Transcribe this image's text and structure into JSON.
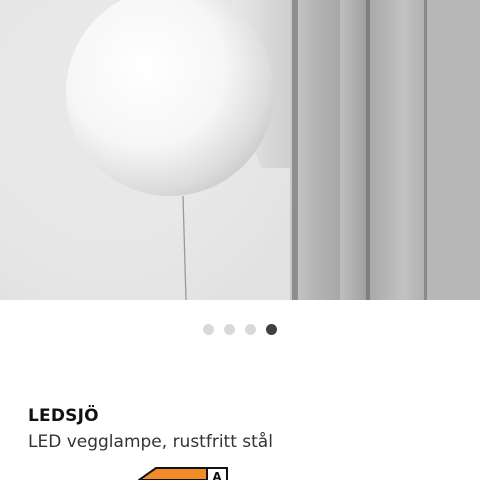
{
  "product": {
    "name": "LEDSJÖ",
    "description": "LED vegglampe, rustfritt stål"
  },
  "carousel": {
    "dot_count": 4,
    "active_index": 3
  },
  "energy_label": {
    "grade": "A",
    "arrow_color": "#f28c28"
  },
  "colors": {
    "dot_inactive": "#d9d9d9",
    "dot_active": "#404040"
  }
}
